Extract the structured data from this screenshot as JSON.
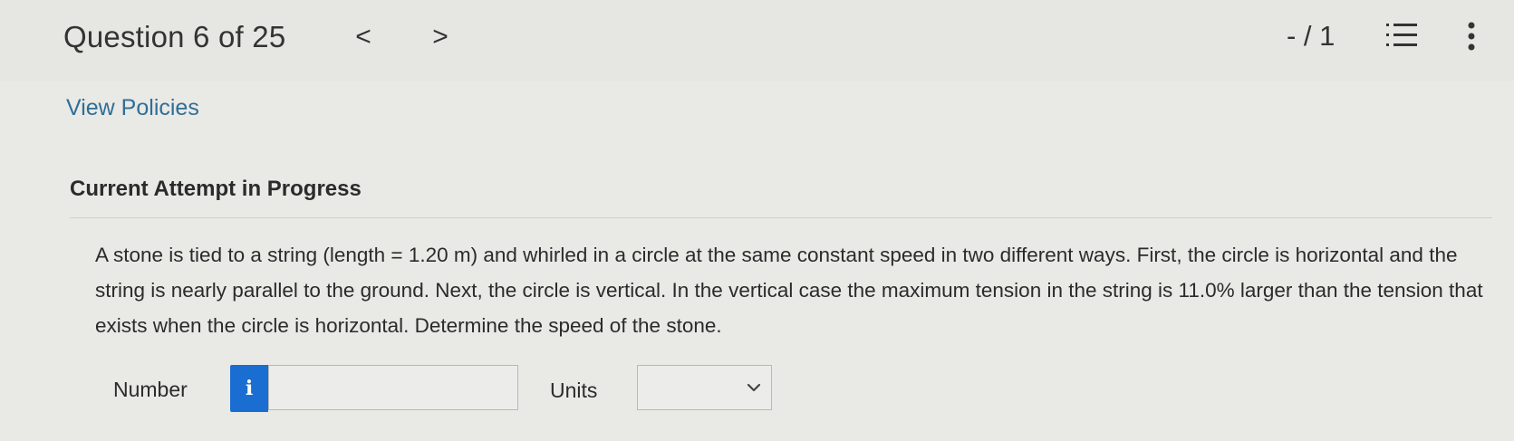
{
  "header": {
    "title": "Question 6 of 25",
    "prev_label": "<",
    "next_label": ">",
    "score": "- / 1"
  },
  "icons": {
    "prev": "chevron-left-icon",
    "next": "chevron-right-icon",
    "list": "numbered-list-icon",
    "more": "vertical-ellipsis-icon",
    "info": "info-icon",
    "dropdown": "chevron-down-icon"
  },
  "links": {
    "view_policies": "View Policies"
  },
  "attempt": {
    "heading": "Current Attempt in Progress"
  },
  "question": {
    "text": "A stone is tied to a string (length = 1.20 m) and whirled in a circle at the same constant speed in two different ways. First, the circle is horizontal and the string is nearly parallel to the ground. Next, the circle is vertical. In the vertical case the maximum tension in the string is 11.0% larger than the tension that exists when the circle is horizontal. Determine the speed of the stone."
  },
  "answer": {
    "number_label": "Number",
    "info_label": "i",
    "number_value": "",
    "units_label": "Units",
    "units_selected": ""
  },
  "colors": {
    "accent": "#1a6ed1",
    "link": "#2f6f96",
    "background": "#e9e9e6"
  }
}
